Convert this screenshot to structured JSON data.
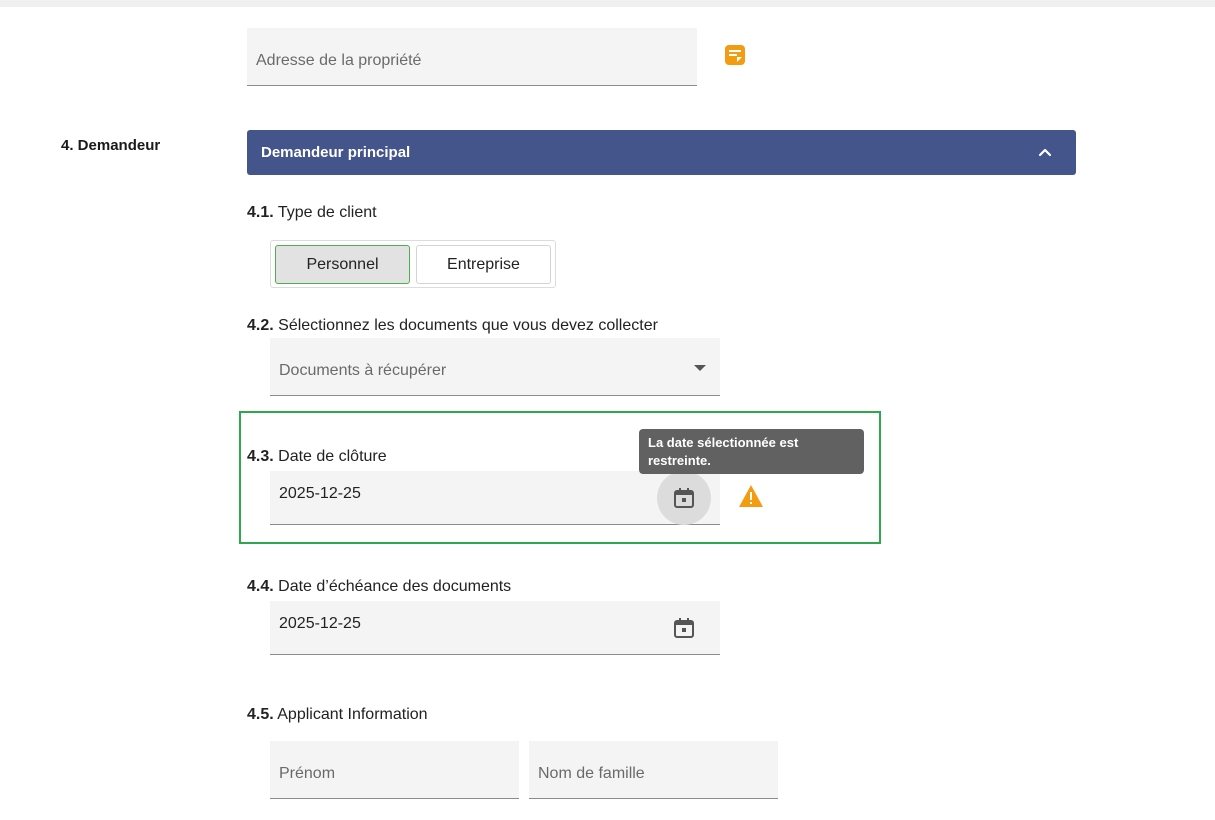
{
  "property": {
    "address_placeholder": "Adresse de la propriété",
    "note_icon": "note-icon"
  },
  "section": {
    "label": "4. Demandeur"
  },
  "panel": {
    "title": "Demandeur principal",
    "collapse_icon": "chevron-up-icon",
    "header_color": "#43558a"
  },
  "questions": {
    "client_type": {
      "num": "4.1.",
      "label": "Type de client",
      "options": [
        "Personnel",
        "Entreprise"
      ],
      "selected": "Personnel"
    },
    "documents": {
      "num": "4.2.",
      "label": "Sélectionnez les documents que vous devez collecter",
      "placeholder": "Documents à récupérer"
    },
    "closing_date": {
      "num": "4.3.",
      "label": "Date de clôture",
      "value": "2025-12-25",
      "tooltip": "La date sélectionnée est restreinte.",
      "warning_color": "#f39c12"
    },
    "due_date": {
      "num": "4.4.",
      "label": "Date d’échéance des documents",
      "value": "2025-12-25"
    },
    "applicant": {
      "num": "4.5.",
      "label": "Applicant Information",
      "first_name_placeholder": "Prénom",
      "last_name_placeholder": "Nom de famille"
    }
  },
  "colors": {
    "highlight": "#2ea84f",
    "accent": "#f39c12"
  }
}
